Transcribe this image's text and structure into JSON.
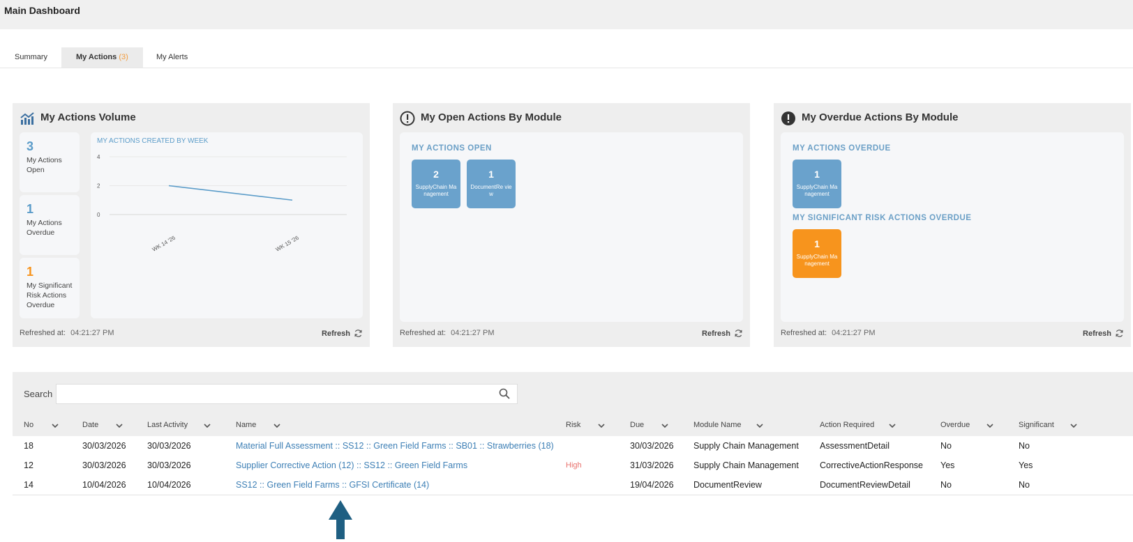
{
  "header": {
    "title": "Main Dashboard"
  },
  "tabs": [
    {
      "label": "Summary"
    },
    {
      "label": "My Actions",
      "count": "(3)"
    },
    {
      "label": "My Alerts"
    }
  ],
  "panels": {
    "volume": {
      "title": "My Actions Volume",
      "stats": [
        {
          "value": "3",
          "label": "My Actions Open",
          "color": "#5b9cc9"
        },
        {
          "value": "1",
          "label": "My Actions Overdue",
          "color": "#5b9cc9"
        },
        {
          "value": "1",
          "label": "My Significant Risk Actions Overdue",
          "color": "#f7941d"
        }
      ],
      "refreshed_label": "Refreshed at:",
      "refreshed_time": "04:21:27 PM",
      "refresh_label": "Refresh"
    },
    "open": {
      "title": "My Open Actions By Module",
      "heading": "MY ACTIONS OPEN",
      "tiles": [
        {
          "value": "2",
          "label": "SupplyChain Management"
        },
        {
          "value": "1",
          "label": "DocumentRe view"
        }
      ],
      "refreshed_label": "Refreshed at:",
      "refreshed_time": "04:21:27 PM",
      "refresh_label": "Refresh"
    },
    "overdue": {
      "title": "My Overdue Actions By Module",
      "heading1": "MY ACTIONS OVERDUE",
      "tiles1": [
        {
          "value": "1",
          "label": "SupplyChain Management"
        }
      ],
      "heading2": "MY SIGNIFICANT RISK ACTIONS OVERDUE",
      "tiles2": [
        {
          "value": "1",
          "label": "SupplyChain Management"
        }
      ],
      "refreshed_label": "Refreshed at:",
      "refreshed_time": "04:21:27 PM",
      "refresh_label": "Refresh"
    }
  },
  "chart_data": {
    "type": "line",
    "title": "MY ACTIONS CREATED BY WEEK",
    "categories": [
      "WK 14 '26",
      "WK 15 '26"
    ],
    "values": [
      2,
      1
    ],
    "ylim": [
      0,
      4
    ],
    "yticks": [
      0,
      2,
      4
    ],
    "grid": true,
    "color": "#5b9cc9"
  },
  "search": {
    "label": "Search",
    "value": ""
  },
  "table": {
    "columns": [
      "No",
      "Date",
      "Last Activity",
      "Name",
      "Risk",
      "Due",
      "Module Name",
      "Action Required",
      "Overdue",
      "Significant"
    ],
    "rows": [
      [
        "18",
        "30/03/2026",
        "30/03/2026",
        "Material Full Assessment :: SS12 :: Green Field Farms :: SB01 :: Strawberries (18)",
        "",
        "30/03/2026",
        "Supply Chain Management",
        "AssessmentDetail",
        "No",
        "No"
      ],
      [
        "12",
        "30/03/2026",
        "30/03/2026",
        "Supplier Corrective Action (12) :: SS12 :: Green Field Farms",
        "High",
        "31/03/2026",
        "Supply Chain Management",
        "CorrectiveActionResponse",
        "Yes",
        "Yes"
      ],
      [
        "14",
        "10/04/2026",
        "10/04/2026",
        "SS12 :: Green Field Farms :: GFSI Certificate (14)",
        "",
        "19/04/2026",
        "DocumentReview",
        "DocumentReviewDetail",
        "No",
        "No"
      ]
    ]
  }
}
